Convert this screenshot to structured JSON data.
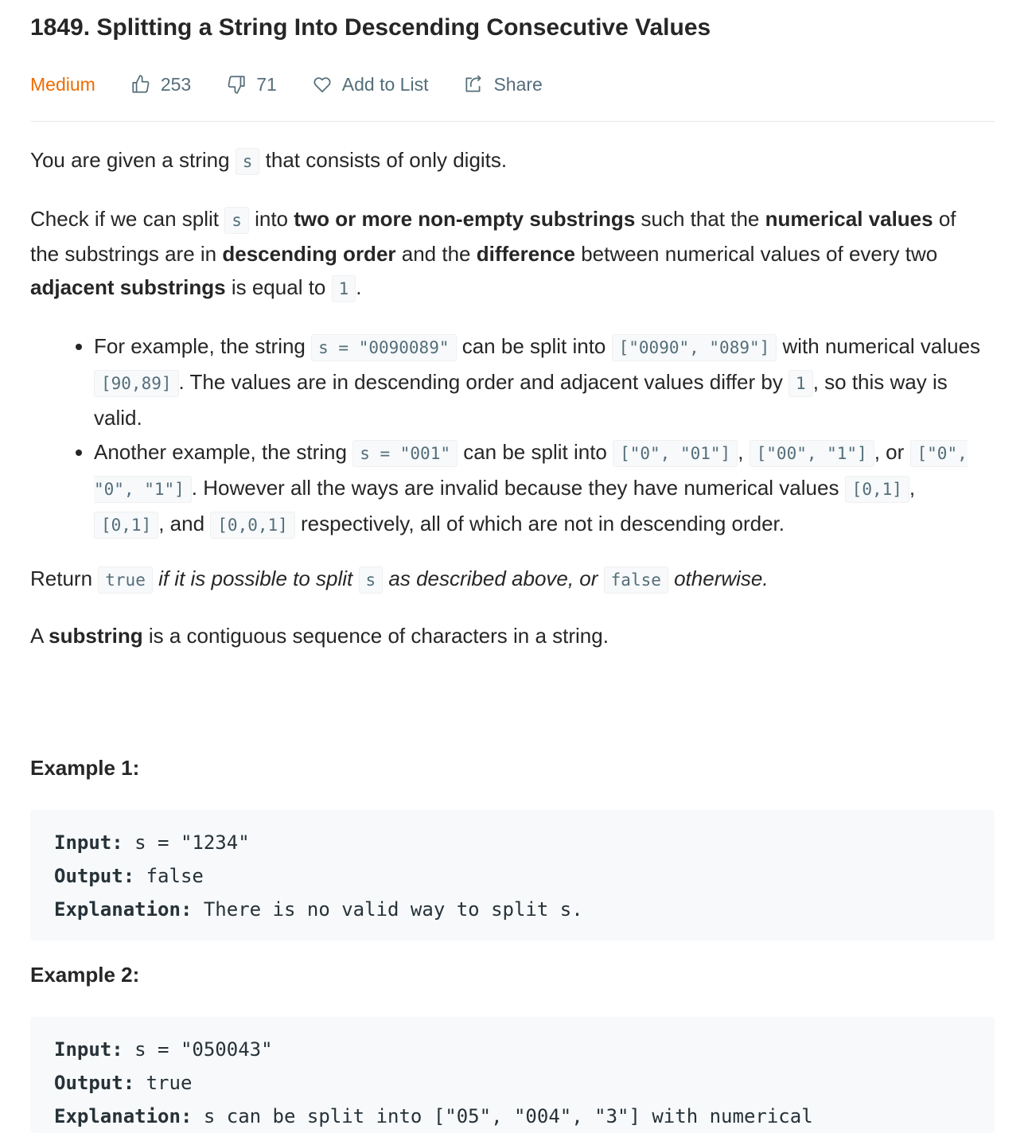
{
  "problem": {
    "title": "1849. Splitting a String Into Descending Consecutive Values",
    "difficulty": "Medium",
    "likes": "253",
    "dislikes": "71",
    "add_to_list_label": "Add to List",
    "share_label": "Share"
  },
  "description": {
    "p1": {
      "t1": "You are given a string ",
      "c1": "s",
      "t2": " that consists of only digits."
    },
    "p2": {
      "t1": "Check if we can split ",
      "c1": "s",
      "t2": " into ",
      "b1": "two or more non-empty substrings",
      "t3": " such that the ",
      "b2": "numerical values",
      "t4": " of the substrings are in ",
      "b3": "descending order",
      "t5": " and the ",
      "b4": "difference",
      "t6": " between numerical values of every two ",
      "b5": "adjacent substrings",
      "t7": " is equal to ",
      "c2": "1",
      "t8": "."
    },
    "bullet1": {
      "t1": "For example, the string ",
      "c1": "s = \"0090089\"",
      "t2": " can be split into ",
      "c2": "[\"0090\", \"089\"]",
      "t3": " with numerical values ",
      "c3": "[90,89]",
      "t4": ". The values are in descending order and adjacent values differ by ",
      "c4": "1",
      "t5": ", so this way is valid."
    },
    "bullet2": {
      "t1": "Another example, the string ",
      "c1": "s = \"001\"",
      "t2": " can be split into ",
      "c2": "[\"0\", \"01\"]",
      "t3": ", ",
      "c3": "[\"00\", \"1\"]",
      "t4": ", or ",
      "c4": "[\"0\", \"0\", \"1\"]",
      "t5": ". However all the ways are invalid because they have numerical values ",
      "c5": "[0,1]",
      "t6": ", ",
      "c6": "[0,1]",
      "t7": ", and ",
      "c7": "[0,0,1]",
      "t8": " respectively, all of which are not in descending order."
    },
    "p3": {
      "t1": "Return ",
      "c1": "true",
      "i1": " if it is possible to split ",
      "c2": "s",
      "i2": " as described above, or ",
      "c3": "false",
      "i3": " otherwise."
    },
    "p4": {
      "t1": "A ",
      "b1": "substring",
      "t2": " is a contiguous sequence of characters in a string."
    }
  },
  "examples": [
    {
      "title": "Example 1:",
      "input_label": "Input:",
      "input": " s = \"1234\"",
      "output_label": "Output:",
      "output": " false",
      "explanation_label": "Explanation:",
      "explanation": " There is no valid way to split s."
    },
    {
      "title": "Example 2:",
      "input_label": "Input:",
      "input": " s = \"050043\"",
      "output_label": "Output:",
      "output": " true",
      "explanation_label": "Explanation:",
      "explanation": " s can be split into [\"05\", \"004\", \"3\"] with numerical"
    }
  ],
  "colors": {
    "difficulty_medium": "#ef6c00",
    "meta_text": "#546e7a",
    "code_bg": "#f7f9fa",
    "text": "#262626"
  },
  "icons": [
    "thumbs-up-icon",
    "thumbs-down-icon",
    "heart-icon",
    "share-icon"
  ]
}
